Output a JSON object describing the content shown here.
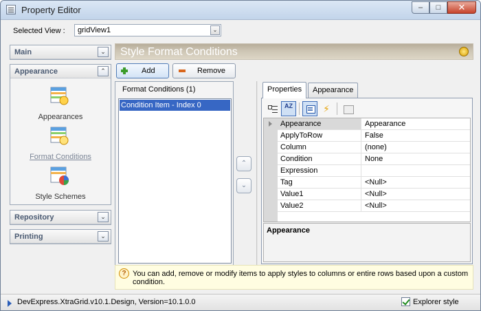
{
  "window": {
    "title": "Property Editor",
    "minimize_glyph": "–",
    "maximize_glyph": "□",
    "close_glyph": "✕"
  },
  "selected_view": {
    "label": "Selected View :",
    "value": "gridView1"
  },
  "nav": {
    "main": "Main",
    "appearance": "Appearance",
    "items": [
      "Appearances",
      "Format Conditions",
      "Style Schemes"
    ],
    "repository": "Repository",
    "printing": "Printing",
    "expand_glyph": "⌄",
    "collapse_glyph": "⌃"
  },
  "panel": {
    "title": "Style Format Conditions"
  },
  "toolbar": {
    "add_label": "Add",
    "remove_label": "Remove"
  },
  "conditions": {
    "header": "Format Conditions (1)",
    "items": [
      "Condition Item - Index 0"
    ],
    "move_up_glyph": "⌃",
    "move_down_glyph": "⌄"
  },
  "tabs": [
    "Properties",
    "Appearance"
  ],
  "property_grid": {
    "sort_glyph": "AZ",
    "events_glyph": "⚡",
    "rows": [
      {
        "name": "Appearance",
        "value": "Appearance"
      },
      {
        "name": "ApplyToRow",
        "value": "False"
      },
      {
        "name": "Column",
        "value": "(none)"
      },
      {
        "name": "Condition",
        "value": "None"
      },
      {
        "name": "Expression",
        "value": ""
      },
      {
        "name": "Tag",
        "value": "<Null>"
      },
      {
        "name": "Value1",
        "value": "<Null>"
      },
      {
        "name": "Value2",
        "value": "<Null>"
      }
    ],
    "description_title": "Appearance"
  },
  "info": {
    "icon_glyph": "?",
    "text": "You can add, remove or modify items to apply styles to columns or entire rows based upon a custom condition."
  },
  "status": {
    "version_text": "DevExpress.XtraGrid.v10.1.Design, Version=10.1.0.0",
    "explorer_style_label": "Explorer style",
    "explorer_style_checked": true
  },
  "colors": {
    "selection": "#3767c4",
    "header_band": "#c6bda9",
    "nav_text": "#4a5a72"
  }
}
